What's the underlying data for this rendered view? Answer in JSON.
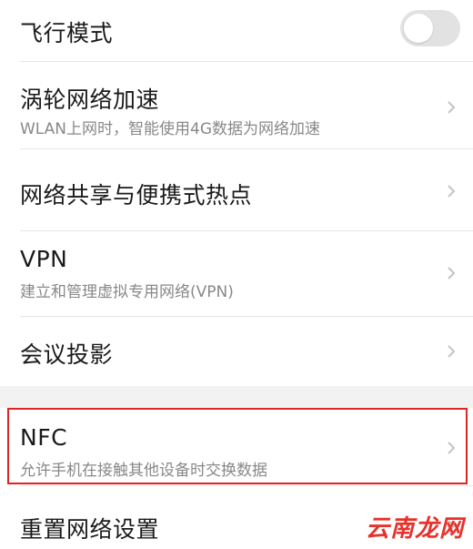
{
  "settings": {
    "airplane_mode": {
      "title": "飞行模式",
      "enabled": false
    },
    "turbo_network": {
      "title": "涡轮网络加速",
      "subtitle": "WLAN上网时，智能使用4G数据为网络加速"
    },
    "hotspot": {
      "title": "网络共享与便携式热点"
    },
    "vpn": {
      "title": "VPN",
      "subtitle": "建立和管理虚拟专用网络(VPN)"
    },
    "projection": {
      "title": "会议投影"
    },
    "nfc": {
      "title": "NFC",
      "subtitle": "允许手机在接触其他设备时交换数据"
    },
    "reset_network": {
      "title": "重置网络设置"
    }
  },
  "watermark": {
    "text": "云南龙网"
  },
  "colors": {
    "highlight_border": "#e02424",
    "watermark": "#e8312b",
    "toggle_off": "#e2e2e2",
    "section_gap": "#f2f2f2"
  },
  "icons": {
    "row_chevron": "chevron-right-icon"
  }
}
